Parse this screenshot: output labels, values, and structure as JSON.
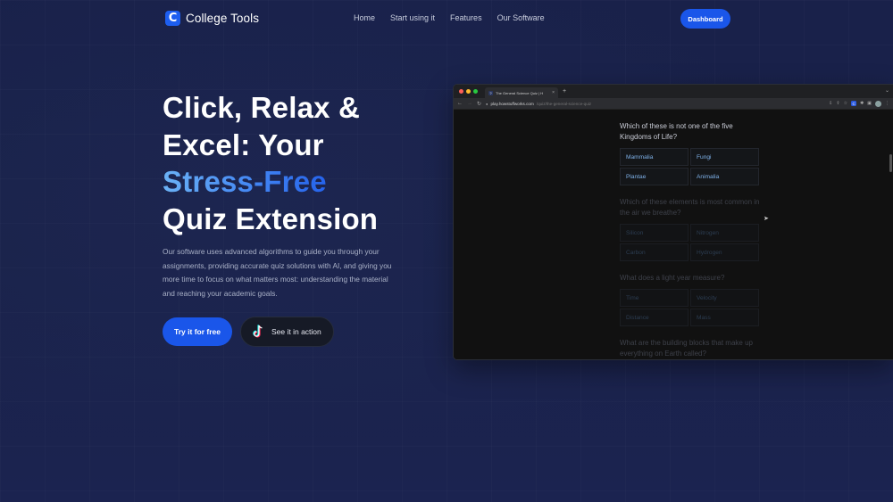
{
  "nav": {
    "logo_letter": "C",
    "brand": "College Tools",
    "links": [
      "Home",
      "Start using it",
      "Features",
      "Our Software"
    ],
    "dashboard_label": "Dashboard"
  },
  "hero": {
    "title_line1": "Click, Relax &",
    "title_line2": "Excel: Your",
    "title_accent": "Stress-Free",
    "title_line4": "Quiz Extension",
    "description": "Our software uses advanced algorithms to guide you through your assignments, providing accurate quiz solutions with AI, and giving you more time to focus on what matters most: understanding the material and reaching your academic goals.",
    "primary_cta": "Try it for free",
    "secondary_cta": "See it in action",
    "secondary_cta_icon": "tiktok-icon"
  },
  "colors": {
    "accent": "#1a56ea",
    "background": "#1a2246",
    "gradient_start": "#6bb2f5",
    "gradient_end": "#2563eb"
  },
  "browser": {
    "tab_title": "The General Science Quiz | H",
    "tab_favicon": "?",
    "url_host": "play.howstuffworks.com",
    "url_path": "/quiz/the-general-science-quiz",
    "questions": [
      {
        "text": "Which of these is not one of the five Kingdoms of Life?",
        "options": [
          "Mammalia",
          "Fungi",
          "Plantae",
          "Animalia"
        ],
        "faded": false
      },
      {
        "text": "Which of these elements is most common in the air we breathe?",
        "options": [
          "Silicon",
          "Nitrogen",
          "Carbon",
          "Hydrogen"
        ],
        "faded": true
      },
      {
        "text": "What does a light year measure?",
        "options": [
          "Time",
          "Velocity",
          "Distance",
          "Mass"
        ],
        "faded": true
      },
      {
        "text": "What are the building blocks that make up everything on Earth called?",
        "options": [],
        "faded": true
      }
    ]
  }
}
